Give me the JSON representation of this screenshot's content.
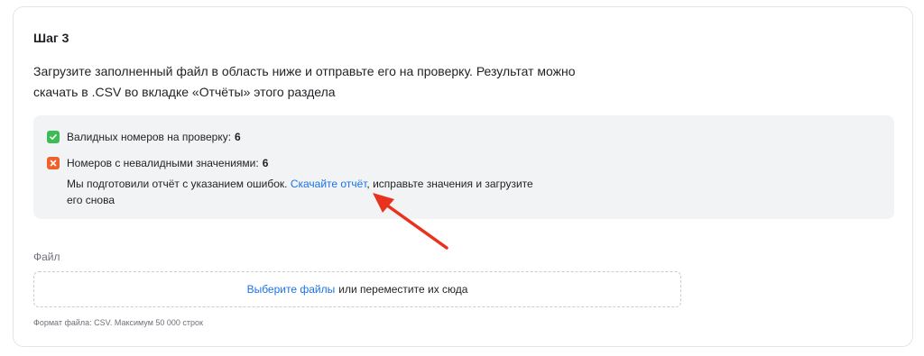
{
  "step": {
    "title": "Шаг 3"
  },
  "description": {
    "line1": "Загрузите заполненный файл в область ниже и отправьте его на проверку. Результат можно",
    "line2": "скачать в .CSV во вкладке «Отчёты» этого раздела"
  },
  "results": {
    "valid": {
      "label": "Валидных номеров на проверку:",
      "count": "6",
      "icon": "check-icon"
    },
    "invalid": {
      "label": "Номеров с невалидными значениями:",
      "count": "6",
      "icon": "cross-icon"
    },
    "note_before": "Мы подготовили отчёт с указанием ошибок. ",
    "note_link": "Скачайте отчёт",
    "note_after": ", исправьте значения и загрузите",
    "note_line2": "его снова"
  },
  "file": {
    "label": "Файл",
    "dropzone_link": "Выберите файлы",
    "dropzone_text": "или переместите их сюда",
    "hint": "Формат файла: CSV. Максимум 50 000 строк"
  },
  "colors": {
    "accent_link": "#1a73e8",
    "success": "#3dbb55",
    "error": "#f0602c",
    "annotation_arrow": "#e8321e"
  }
}
